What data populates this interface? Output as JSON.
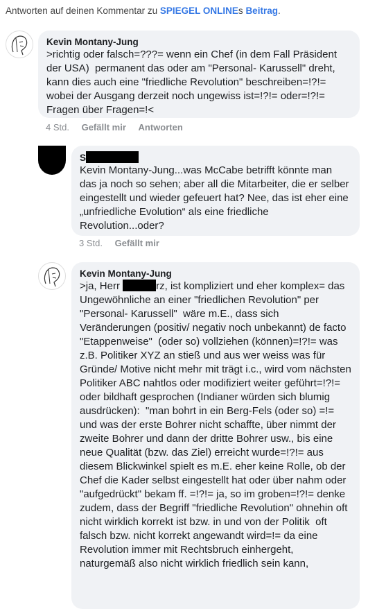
{
  "notice": {
    "prefix": "Antworten auf deinen Kommentar zu ",
    "page_link": "SPIEGEL ONLINE",
    "middle": "s ",
    "post_link": "Beitrag",
    "suffix": "."
  },
  "comments": [
    {
      "author": "Kevin Montany-Jung",
      "text": ">richtig oder falsch=???= wenn ein Chef (in dem Fall Präsident der USA)  permanent das oder am \"Personal- Karussell\" dreht, kann dies auch eine \"friedliche Revolution\" beschreiben=!?!= wobei der Ausgang derzeit noch ungewiss ist=!?!= oder=!?!= Fragen über Fragen=!<",
      "time": "4 Std.",
      "like": "Gefällt mir",
      "reply": "Antworten"
    },
    {
      "author_initial": "S",
      "text": "Kevin Montany-Jung...was McCabe betrifft könnte man das ja noch so sehen; aber all die Mitarbeiter, die er selber eingestellt und wieder gefeuert hat? Nee, das ist eher eine „unfriedliche Evolution“ als eine friedliche Revolution...oder?",
      "time": "3 Std.",
      "like": "Gefällt mir"
    },
    {
      "author": "Kevin Montany-Jung",
      "text_before": ">ja, Herr ",
      "text_redacted_tail": "rz",
      "text_after": ", ist kompliziert und eher komplex= das Ungewöhnliche an einer \"friedlichen Revolution\" per  \"Personal- Karussell\"  wäre m.E., dass sich Veränderungen (positiv/ negativ noch unbekannt) de facto \"Etappenweise\"  (oder so) vollziehen (können)=!?!= was z.B. Politiker XYZ an stieß und aus wer weiss was für Gründe/ Motive nicht mehr mit trägt i.c., wird vom nächsten Politiker ABC nahtlos oder modifiziert weiter geführt=!?!= oder bildhaft gesprochen (Indianer würden sich blumig ausdrücken):  \"man bohrt in ein Berg-Fels (oder so) =!= und was der erste Bohrer nicht schaffte, über nimmt der zweite Bohrer und dann der dritte Bohrer usw., bis eine neue Qualität (bzw. das Ziel) erreicht wurde=!?!= aus diesem Blickwinkel spielt es m.E. eher keine Rolle, ob der Chef die Kader selbst eingestellt hat oder über nahm oder \"aufgedrückt\" bekam ff. =!?!= ja, so im groben=!?!= denke zudem, dass der Begriff \"friedliche Revolution\" ohnehin oft nicht wirklich korrekt ist bzw. in und von der Politik  oft falsch bzw. nicht korrekt angewandt wird=!= da eine Revolution immer mit Rechtsbruch einhergeht, naturgemäß also nicht wirklich friedlich sein kann,"
    }
  ]
}
